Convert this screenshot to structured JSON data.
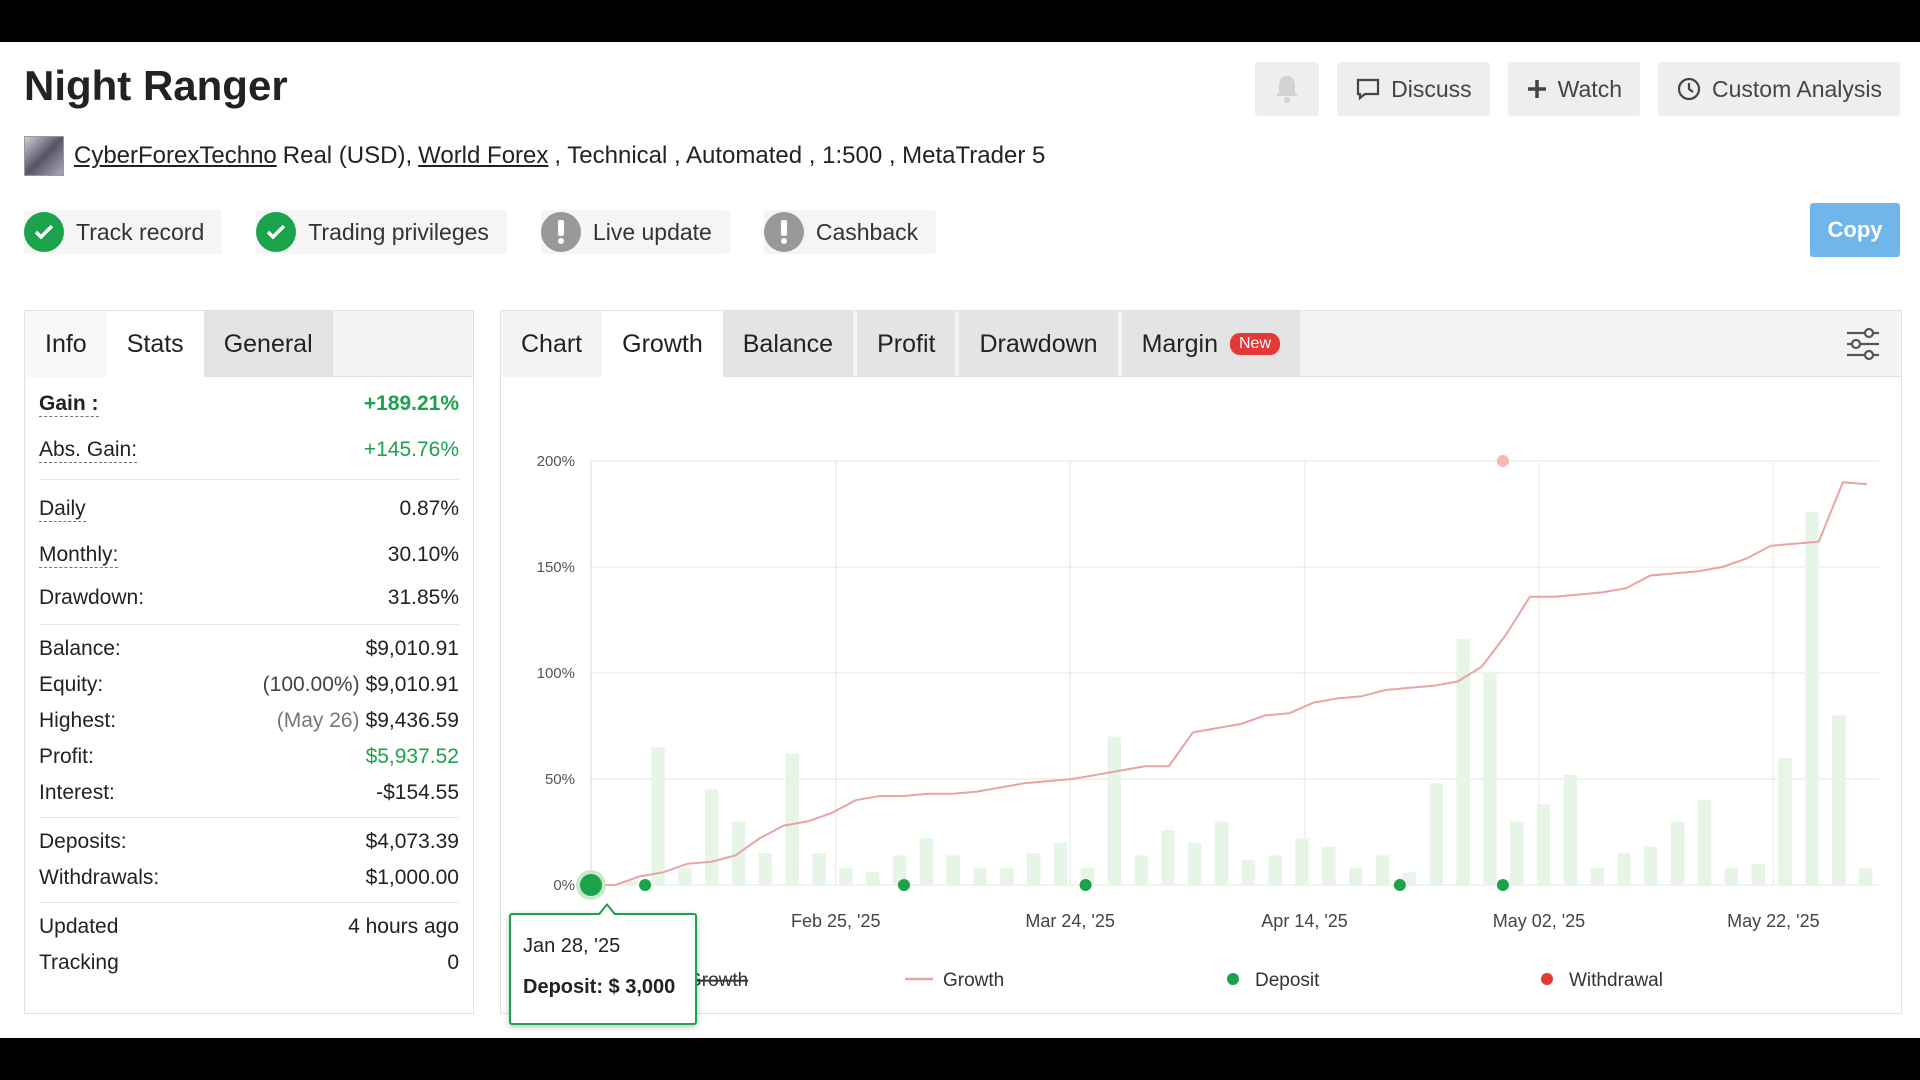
{
  "header": {
    "title": "Night Ranger"
  },
  "toolbar": {
    "discuss": "Discuss",
    "watch": "Watch",
    "custom": "Custom Analysis"
  },
  "meta": {
    "author": "CyberForexTechno",
    "account": "Real (USD),",
    "broker": "World Forex",
    "rest": ", Technical , Automated , 1:500 , MetaTrader 5"
  },
  "badges": [
    {
      "label": "Track record",
      "status": "ok"
    },
    {
      "label": "Trading privileges",
      "status": "ok"
    },
    {
      "label": "Live update",
      "status": "warn"
    },
    {
      "label": "Cashback",
      "status": "warn"
    }
  ],
  "copy_label": "Copy",
  "left_tabs": [
    "Info",
    "Stats",
    "General"
  ],
  "stats": {
    "gain_label": "Gain :",
    "gain": "+189.21%",
    "abs_label": "Abs. Gain:",
    "abs": "+145.76%",
    "daily_label": "Daily",
    "daily": "0.87%",
    "monthly_label": "Monthly:",
    "monthly": "30.10%",
    "dd_label": "Drawdown:",
    "dd": "31.85%",
    "balance_label": "Balance:",
    "balance": "$9,010.91",
    "equity_label": "Equity:",
    "equity_pct": "(100.00%)",
    "equity": "$9,010.91",
    "highest_label": "Highest:",
    "highest_date": "(May 26)",
    "highest": "$9,436.59",
    "profit_label": "Profit:",
    "profit": "$5,937.52",
    "interest_label": "Interest:",
    "interest": "-$154.55",
    "deposits_label": "Deposits:",
    "deposits": "$4,073.39",
    "withdrawals_label": "Withdrawals:",
    "withdrawals": "$1,000.00",
    "updated_label": "Updated",
    "updated": "4 hours ago",
    "tracking_label": "Tracking",
    "tracking": "0"
  },
  "chart_tabs": {
    "chart": "Chart",
    "growth": "Growth",
    "balance": "Balance",
    "profit": "Profit",
    "drawdown": "Drawdown",
    "margin": "Margin",
    "new": "New"
  },
  "tooltip": {
    "date": "Jan 28, '25",
    "value": "Deposit: $ 3,000"
  },
  "chart_data": {
    "type": "line",
    "y_ticks": [
      "0%",
      "50%",
      "100%",
      "150%",
      "200%"
    ],
    "ylim": [
      0,
      200
    ],
    "x_ticks": [
      "Feb 25, '25",
      "Mar 24, '25",
      "Apr 14, '25",
      "May 02, '25",
      "May 22, '25"
    ],
    "legend": [
      "Growth",
      "Growth",
      "Deposit",
      "Withdrawal"
    ],
    "legend_partial_first": "Growth",
    "colors": {
      "growth": "#e8a4a4",
      "deposit": "#1aa34a",
      "withdrawal": "#e53935",
      "bar": "#e6f5e6"
    },
    "growth": [
      0,
      0,
      4,
      6,
      10,
      11,
      14,
      22,
      28,
      30,
      34,
      40,
      42,
      42,
      43,
      43,
      44,
      46,
      48,
      49,
      50,
      52,
      54,
      56,
      56,
      72,
      74,
      76,
      80,
      81,
      86,
      88,
      89,
      92,
      93,
      94,
      96,
      103,
      118,
      136,
      136,
      137,
      138,
      140,
      146,
      147,
      148,
      150,
      154,
      160,
      161,
      162,
      190,
      189
    ],
    "bars": [
      0,
      2,
      65,
      8,
      45,
      30,
      15,
      62,
      15,
      8,
      6,
      14,
      22,
      14,
      8,
      8,
      15,
      20,
      8,
      70,
      14,
      26,
      20,
      30,
      12,
      14,
      22,
      18,
      8,
      14,
      6,
      48,
      116,
      100,
      30,
      38,
      52,
      8,
      15,
      18,
      30,
      40,
      8,
      10,
      60,
      176,
      80,
      8
    ],
    "deposits_idx": [
      0.0,
      0.042,
      0.243,
      0.384,
      0.628,
      0.708
    ],
    "withdrawal_idx": 0.708,
    "withdrawal_value": 200
  }
}
